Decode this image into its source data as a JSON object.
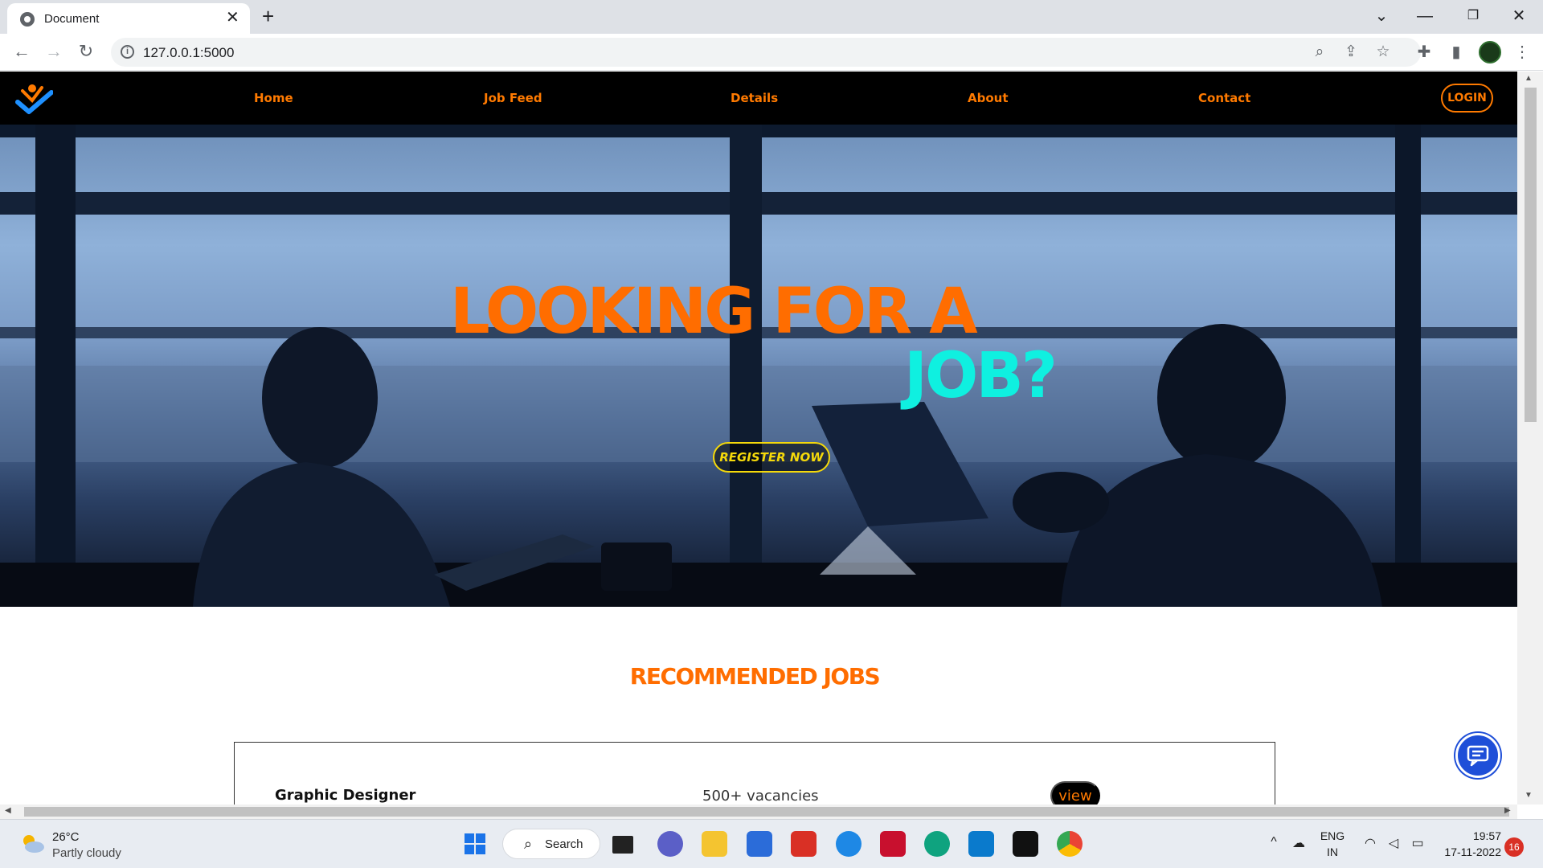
{
  "browser": {
    "tab_title": "Document",
    "url": "127.0.0.1:5000"
  },
  "site": {
    "nav": {
      "items": [
        {
          "label": "Home"
        },
        {
          "label": "Job Feed"
        },
        {
          "label": "Details"
        },
        {
          "label": "About"
        },
        {
          "label": "Contact"
        }
      ],
      "login_label": "LOGIN"
    },
    "hero": {
      "line1": "LOOKING FOR A",
      "line2": "JOB?",
      "register_label": "REGISTER NOW"
    },
    "recommended": {
      "title": "RECOMMENDED JOBS",
      "jobs": [
        {
          "title": "Graphic Designer",
          "vacancies": "500+ vacancies",
          "action": "view"
        }
      ]
    },
    "colors": {
      "accent_orange": "#ff6d00",
      "hero_cyan": "#0ff0e0",
      "register_yellow": "#f5d90a",
      "chat_blue": "#1f4fd8"
    }
  },
  "taskbar": {
    "weather_temp": "26°C",
    "weather_desc": "Partly cloudy",
    "search_label": "Search",
    "lang_top": "ENG",
    "lang_bottom": "IN",
    "time": "19:57",
    "date": "17-11-2022",
    "notification_count": "16"
  }
}
